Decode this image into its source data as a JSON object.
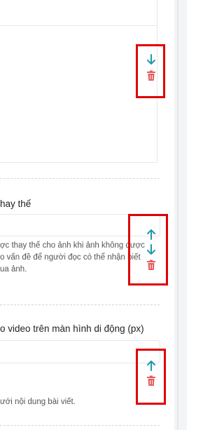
{
  "fields": {
    "alt_label": "hay thế",
    "alt_help_line1": "ợc thay thế cho ảnh khi ảnh không được",
    "alt_help_line2": "o vấn đề để người đọc có thể nhận biết",
    "alt_help_line3": "ua ảnh.",
    "video_label": "o video trên màn hình di động (px)",
    "bottom_help": "ưới nội dung bài viết."
  },
  "icons": {
    "move_down": "arrow-down-icon",
    "move_up": "arrow-up-icon",
    "delete": "trash-icon"
  },
  "colors": {
    "icon_teal": "#1b9aaa",
    "icon_red": "#e45a5a",
    "highlight_red": "#e00000"
  }
}
